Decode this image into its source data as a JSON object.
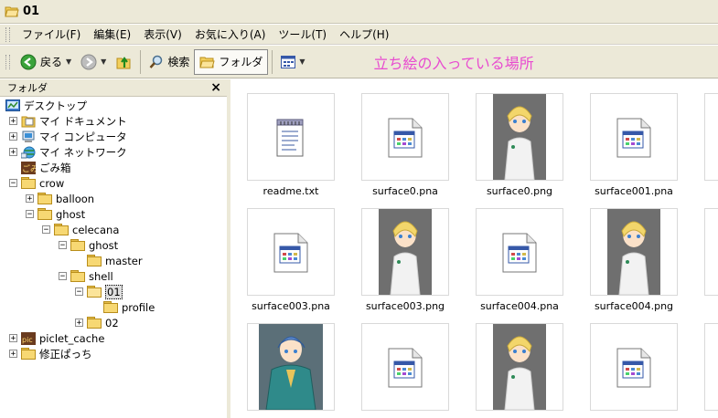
{
  "window": {
    "title": "01"
  },
  "menu": [
    "ファイル(F)",
    "編集(E)",
    "表示(V)",
    "お気に入り(A)",
    "ツール(T)",
    "ヘルプ(H)"
  ],
  "toolbar": {
    "back": "戻る",
    "search": "検索",
    "folders": "フォルダ"
  },
  "annotation": "立ち絵の入っている場所",
  "folder_pane": {
    "header": "フォルダ",
    "tree": [
      {
        "label": "デスクトップ",
        "depth": 0,
        "toggle": "",
        "icon": "desktop-icon"
      },
      {
        "label": "マイ ドキュメント",
        "depth": 1,
        "toggle": "+",
        "icon": "my-documents-icon"
      },
      {
        "label": "マイ コンピュータ",
        "depth": 1,
        "toggle": "+",
        "icon": "my-computer-icon"
      },
      {
        "label": "マイ ネットワーク",
        "depth": 1,
        "toggle": "+",
        "icon": "my-network-icon"
      },
      {
        "label": "ごみ箱",
        "depth": 1,
        "toggle": "",
        "icon": "recycle-bin-icon"
      },
      {
        "label": "crow",
        "depth": 1,
        "toggle": "-",
        "icon": "folder-icon"
      },
      {
        "label": "balloon",
        "depth": 2,
        "toggle": "+",
        "icon": "folder-icon"
      },
      {
        "label": "ghost",
        "depth": 2,
        "toggle": "-",
        "icon": "folder-icon"
      },
      {
        "label": "celecana",
        "depth": 3,
        "toggle": "-",
        "icon": "folder-icon"
      },
      {
        "label": "ghost",
        "depth": 4,
        "toggle": "-",
        "icon": "folder-icon"
      },
      {
        "label": "master",
        "depth": 5,
        "toggle": "",
        "icon": "folder-icon"
      },
      {
        "label": "shell",
        "depth": 4,
        "toggle": "-",
        "icon": "folder-icon"
      },
      {
        "label": "01",
        "depth": 5,
        "toggle": "-",
        "icon": "folder-open-icon",
        "selected": true
      },
      {
        "label": "profile",
        "depth": 6,
        "toggle": "",
        "icon": "folder-icon"
      },
      {
        "label": "02",
        "depth": 5,
        "toggle": "+",
        "icon": "folder-icon"
      },
      {
        "label": "piclet_cache",
        "depth": 1,
        "toggle": "+",
        "icon": "special-folder-icon"
      },
      {
        "label": "修正ぱっち",
        "depth": 1,
        "toggle": "+",
        "icon": "folder-icon"
      }
    ]
  },
  "files": [
    {
      "name": "readme.txt",
      "kind": "text"
    },
    {
      "name": "surface0.pna",
      "kind": "file"
    },
    {
      "name": "surface0.png",
      "kind": "image"
    },
    {
      "name": "surface001.pna",
      "kind": "file"
    },
    {
      "name": "s",
      "kind": "file"
    },
    {
      "name": "surface003.pna",
      "kind": "file"
    },
    {
      "name": "surface003.png",
      "kind": "image"
    },
    {
      "name": "surface004.pna",
      "kind": "file"
    },
    {
      "name": "surface004.png",
      "kind": "image"
    },
    {
      "name": "s",
      "kind": "file"
    },
    {
      "name": "",
      "kind": "image-blue"
    },
    {
      "name": "",
      "kind": "file"
    },
    {
      "name": "",
      "kind": "image"
    },
    {
      "name": "",
      "kind": "file"
    },
    {
      "name": "",
      "kind": "file"
    }
  ],
  "colors": {
    "chrome": "#ece9d8",
    "annotation": "#e84bd0",
    "folder": "#f7d873"
  }
}
